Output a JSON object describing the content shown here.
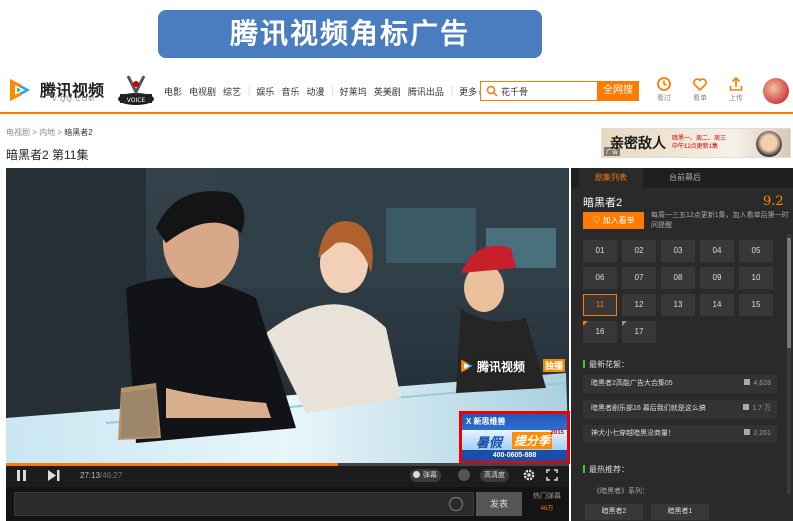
{
  "banner": {
    "title": "腾讯视频角标广告"
  },
  "header": {
    "logo_name": "腾讯视频",
    "logo_url": "V.QQ.COM",
    "nav": [
      "电影",
      "电视剧",
      "综艺",
      "娱乐",
      "音乐",
      "动漫",
      "好莱坞",
      "英美剧",
      "腾讯出品",
      "更多 ▸"
    ],
    "search_value": "花千骨",
    "search_button": "全网搜",
    "icons": [
      {
        "name": "history",
        "label": "看过"
      },
      {
        "name": "follow",
        "label": "看单"
      },
      {
        "name": "upload",
        "label": "上传"
      }
    ]
  },
  "breadcrumb": {
    "a": "电视剧",
    "b": "内地",
    "c": "暗黑者2"
  },
  "episode_title": "暗黑者2 第11集",
  "top_ad": {
    "title": "亲密敌人",
    "schedule_1": "暗黑一、周二、周三",
    "schedule_2": "中午12点更新1集",
    "tag": "广告"
  },
  "player": {
    "watermark": "腾讯视频",
    "watermark_badge": "独播",
    "progress": 0.59,
    "time_current": "27:13",
    "time_total": "/46:27",
    "danmu": "弹幕",
    "quality": "高清度",
    "send": "发表",
    "hot_label": "热门弹幕",
    "hot_count": "46万"
  },
  "corner_ad": {
    "brand": "X 新思维兽",
    "year": "2015",
    "line_a": "暑假",
    "line_b": "提分季",
    "phone": "400-0605-888"
  },
  "panel": {
    "tab_list": "剧集列表",
    "tab_behind": "台前幕后",
    "show_title": "暗黑者2",
    "score": "9.2",
    "follow": "加入看单",
    "schedule": "每周一三五12点更新1集，加入看单后第一时间提醒",
    "episodes": [
      "01",
      "02",
      "03",
      "04",
      "05",
      "06",
      "07",
      "08",
      "09",
      "10",
      "11",
      "12",
      "13",
      "14",
      "15",
      "16",
      "17"
    ],
    "current_episode": "11",
    "sec_clips": "最新花絮：",
    "clips": [
      {
        "title": "暗黑者2高能广告大合集05",
        "count": "4,628"
      },
      {
        "title": "暗黑者剧乐部16 幕后我们就是这么搞",
        "count": "1.7 万"
      },
      {
        "title": "神犬小七穿越暗黑没商量！",
        "count": "2,261"
      }
    ],
    "sec_recommend": "最热推荐：",
    "series": "《暗黑者》系列：",
    "related": [
      "暗黑者2",
      "暗黑者1"
    ]
  }
}
